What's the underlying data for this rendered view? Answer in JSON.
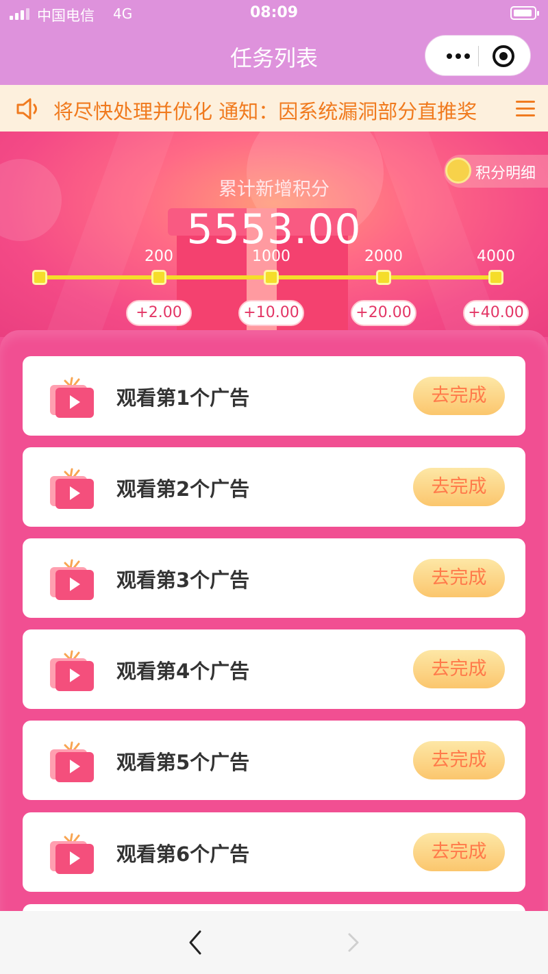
{
  "status_bar": {
    "carrier": "中国电信",
    "network": "4G",
    "time": "08:09"
  },
  "nav": {
    "title": "任务列表",
    "more_icon": "more-dots-icon",
    "close_icon": "target-circle-icon"
  },
  "notice": {
    "text": "将尽快处理并优化 通知：因系统漏洞部分直推奖",
    "icon": "speaker-icon",
    "menu_icon": "hamburger-menu-icon"
  },
  "hero": {
    "label": "累计新增积分",
    "total": "5553.00",
    "points_detail_label": "积分明细",
    "coin_icon": "coin-icon",
    "milestones": [
      {
        "threshold": "200",
        "reward": "+2.00"
      },
      {
        "threshold": "1000",
        "reward": "+10.00"
      },
      {
        "threshold": "2000",
        "reward": "+20.00"
      },
      {
        "threshold": "4000",
        "reward": "+40.00"
      }
    ]
  },
  "tasks": [
    {
      "name": "观看第1个广告",
      "action": "去完成",
      "icon": "tv-play-icon"
    },
    {
      "name": "观看第2个广告",
      "action": "去完成",
      "icon": "tv-play-icon"
    },
    {
      "name": "观看第3个广告",
      "action": "去完成",
      "icon": "tv-play-icon"
    },
    {
      "name": "观看第4个广告",
      "action": "去完成",
      "icon": "tv-play-icon"
    },
    {
      "name": "观看第5个广告",
      "action": "去完成",
      "icon": "tv-play-icon"
    },
    {
      "name": "观看第6个广告",
      "action": "去完成",
      "icon": "tv-play-icon"
    }
  ],
  "bottom_nav": {
    "back_icon": "chevron-left-icon",
    "forward_icon": "chevron-right-icon"
  },
  "colors": {
    "header_bg": "#de92dc",
    "notice_bg": "#fdf0dd",
    "notice_text": "#f07a1e",
    "panel_bg": "#f14f92",
    "button_gradient_top": "#fde7a6",
    "button_gradient_bottom": "#fbc66d",
    "button_text": "#ff7a4a",
    "progress_track": "#f5dd2a"
  }
}
